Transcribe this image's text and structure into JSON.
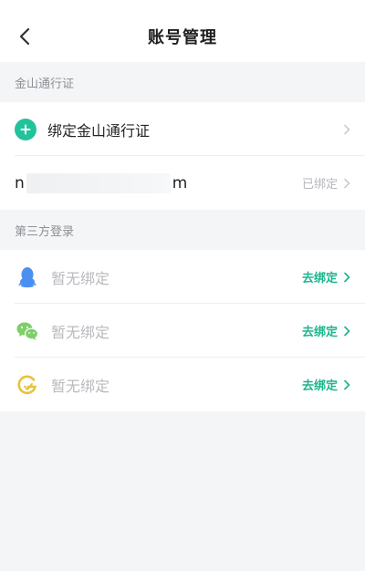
{
  "header": {
    "title": "账号管理",
    "back_icon": "chevron-left-icon"
  },
  "kingsoft_section": {
    "label": "金山通行证",
    "bind_row": {
      "label": "绑定金山通行证",
      "icon": "plus-circle-icon",
      "accent": "#22c39b"
    },
    "account_row": {
      "prefix": "n",
      "suffix": "m",
      "status": "已绑定"
    }
  },
  "third_party_section": {
    "label": "第三方登录",
    "items": [
      {
        "icon": "qq-penguin-icon",
        "status": "暂无绑定",
        "action": "去绑定",
        "color": "#4a90f0"
      },
      {
        "icon": "wechat-icon",
        "status": "暂无绑定",
        "action": "去绑定",
        "color": "#7fce6a"
      },
      {
        "icon": "weibo-g-icon",
        "status": "暂无绑定",
        "action": "去绑定",
        "color": "#e8c23a"
      }
    ]
  },
  "colors": {
    "action_green": "#1db58d",
    "muted_text": "#b5b7bb",
    "background": "#f4f5f7"
  }
}
